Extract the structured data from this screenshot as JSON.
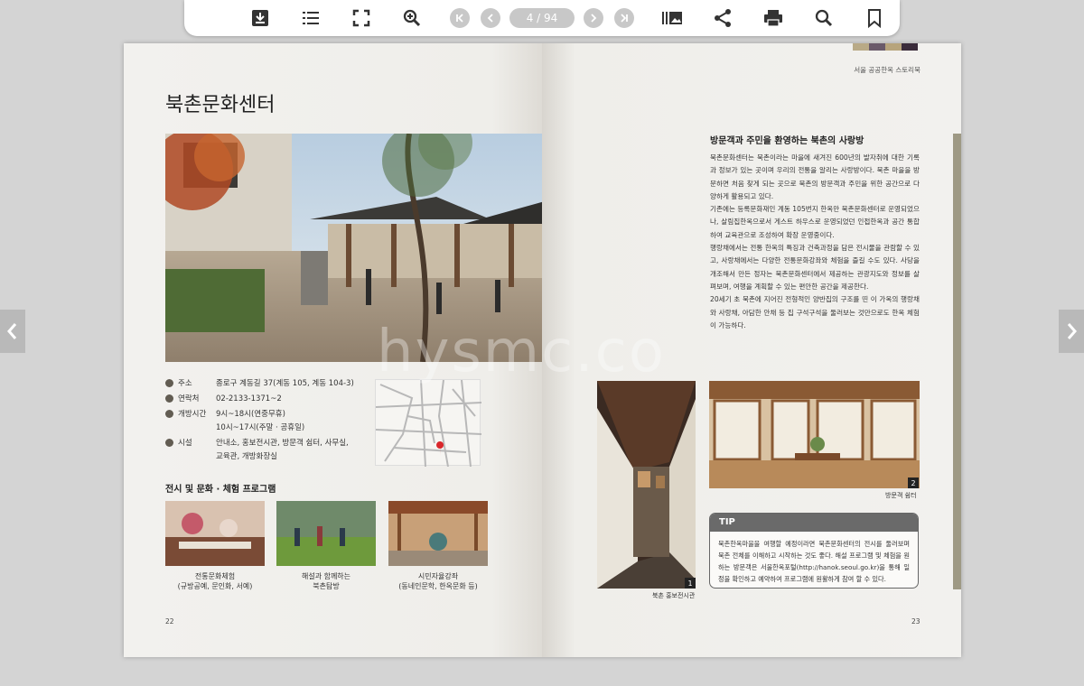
{
  "toolbar": {
    "icons": [
      "download-icon",
      "list-icon",
      "fullscreen-icon",
      "zoom-in-icon",
      "first-page-icon",
      "prev-page-icon",
      "next-page-icon",
      "last-page-icon",
      "thumbnails-icon",
      "share-icon",
      "print-icon",
      "search-icon",
      "bookmark-icon"
    ],
    "page_indicator": "4 / 94"
  },
  "left_page": {
    "title": "북촌문화센터",
    "info": [
      {
        "label": "주소",
        "value": "종로구 계동길 37(계동 105, 계동 104-3)"
      },
      {
        "label": "연락처",
        "value": "02-2133-1371~2"
      },
      {
        "label": "개방시간",
        "value": "9시~18시(연중무휴)",
        "value2": "10시~17시(주말 · 공휴일)"
      },
      {
        "label": "시설",
        "value": "안내소, 홍보전시관, 방문객 쉼터, 사무실,",
        "value2": "교육관, 개방화장실"
      }
    ],
    "programs_heading": "전시 및 문화 · 체험 프로그램",
    "programs": [
      {
        "line1": "전통문화체험",
        "line2": "(규방공예, 문인화, 서예)"
      },
      {
        "line1": "해설과 함께하는",
        "line2": "북촌탐방"
      },
      {
        "line1": "시민자율강좌",
        "line2": "(동네인문학, 한옥문화 등)"
      }
    ],
    "page_number": "22"
  },
  "right_page": {
    "running_header": "서울 공공한옥 스토리북",
    "heading": "방문객과 주민을 환영하는 북촌의 사랑방",
    "paragraphs": [
      "북촌문화센터는 북촌이라는 마을에 새겨진 600년의 발자취에 대한 기록과 정보가 있는 곳이며 우리의 전통을 알리는 사랑방이다. 북촌 마을을 방문하면 처음 찾게 되는 곳으로 북촌의 방문객과 주민을 위한 공간으로 다양하게 활용되고 있다.",
      "기존에는 등록문화재인 계동 105번지 한옥만 북촌문화센터로 운영되었으나, 살림집한옥으로서 게스트 하우스로 운영되었던 인접한옥과 공간 통합하여 교육관으로 조성하여 확장 운영중이다.",
      "행랑채에서는 전통 한옥의 특징과 건축과정을 담은 전시물을 관람할 수 있고, 사랑채에서는 다양한 전통문화강좌와 체험을 즐길 수도 있다. 사당을 개조해서 만든 정자는 북촌문화센터에서 제공하는 관광지도와 정보를 살펴보며, 여행을 계획할 수 있는 편안한 공간을 제공한다.",
      "20세기 초 북촌에 지어진 전형적인 양반집의 구조를 띤 이 가옥의 행랑채와 사랑채, 아담한 안채 등 집 구석구석을 둘러보는 것만으로도 한옥 체험이 가능하다."
    ],
    "photo1_badge": "1",
    "photo1_caption": "북촌 홍보전시관",
    "photo2_badge": "2",
    "photo2_caption": "방문객 쉼터",
    "tip_title": "TIP",
    "tip_text": "북촌한옥마을을 여행할 예정이라면 북촌문화센터의 전시를 둘러보며 북촌 전체를 이해하고 시작하는 것도 좋다. 해설 프로그램 및 체험을 원하는 방문객은 서울한옥포털(http://hanok.seoul.go.kr)을 통해 일정을 확인하고 예약하여 프로그램에 원활하게 참여 할 수 있다.",
    "page_number": "23"
  },
  "watermark": "hysmc.co",
  "colors": {
    "swatches": [
      "#b9aa87",
      "#6a5a6a",
      "#b7a47c",
      "#3b2c3b"
    ],
    "accent_strip": "#9e9984"
  }
}
